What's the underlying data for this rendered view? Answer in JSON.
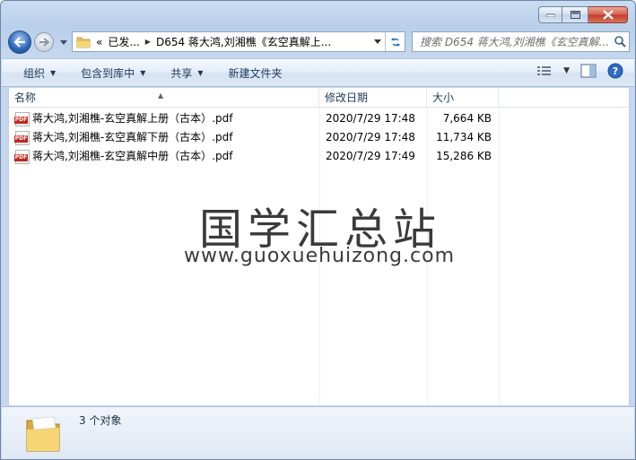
{
  "window": {
    "caption_buttons": [
      "minimize",
      "maximize",
      "close"
    ]
  },
  "address": {
    "crumbs": [
      "«",
      "已发...",
      "D654 蒋大鸿,刘湘樵《玄空真解上..."
    ]
  },
  "search": {
    "placeholder": "搜索 D654 蒋大鸿,刘湘樵《玄空真解..."
  },
  "toolbar": {
    "organize": "组织",
    "include_in_library": "包含到库中",
    "share": "共享",
    "new_folder": "新建文件夹"
  },
  "columns": {
    "name": "名称",
    "date_modified": "修改日期",
    "size": "大小"
  },
  "files": [
    {
      "name": "蒋大鸿,刘湘樵-玄空真解上册（古本）.pdf",
      "date": "2020/7/29 17:48",
      "size": "7,664 KB"
    },
    {
      "name": "蒋大鸿,刘湘樵-玄空真解下册（古本）.pdf",
      "date": "2020/7/29 17:48",
      "size": "11,734 KB"
    },
    {
      "name": "蒋大鸿,刘湘樵-玄空真解中册（古本）.pdf",
      "date": "2020/7/29 17:49",
      "size": "15,286 KB"
    }
  ],
  "watermark": {
    "title": "国学汇总站",
    "url": "www.guoxuehuizong.com"
  },
  "details": {
    "count_text": "3 个对象"
  },
  "colors": {
    "accent": "#1e395b",
    "pdf_red": "#c0281e",
    "close_red": "#c23a24"
  }
}
